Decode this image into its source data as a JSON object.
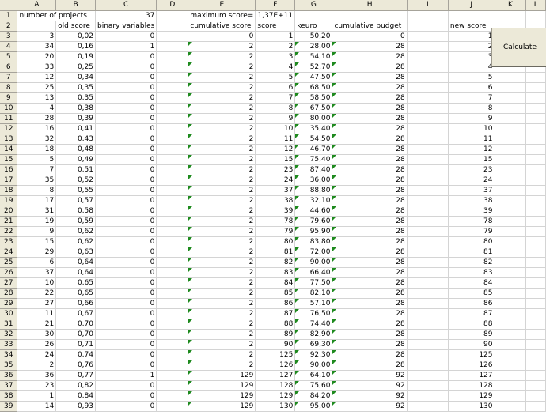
{
  "columns": [
    "A",
    "B",
    "C",
    "D",
    "E",
    "F",
    "G",
    "H",
    "I",
    "J",
    "K",
    "L"
  ],
  "row1": {
    "a": "number of projects",
    "c": "37",
    "e": "maximum score=",
    "f": "1,37E+11"
  },
  "row2": {
    "b": "old score",
    "c": "binary variables",
    "e": "cumulative score",
    "f": "score",
    "g": "keuro",
    "h": "cumulative budget",
    "j": "new score"
  },
  "rows": [
    {
      "n": "3",
      "a": "3",
      "b": "0,02",
      "c": "0",
      "e": "0",
      "f": "1",
      "g": "50,20",
      "h": "0",
      "j": "1"
    },
    {
      "n": "4",
      "a": "34",
      "b": "0,16",
      "c": "1",
      "e": "2",
      "f": "2",
      "g": "28,00",
      "h": "28",
      "j": "2"
    },
    {
      "n": "5",
      "a": "20",
      "b": "0,19",
      "c": "0",
      "e": "2",
      "f": "3",
      "g": "54,10",
      "h": "28",
      "j": "3"
    },
    {
      "n": "6",
      "a": "33",
      "b": "0,25",
      "c": "0",
      "e": "2",
      "f": "4",
      "g": "52,70",
      "h": "28",
      "j": "4"
    },
    {
      "n": "7",
      "a": "12",
      "b": "0,34",
      "c": "0",
      "e": "2",
      "f": "5",
      "g": "47,50",
      "h": "28",
      "j": "5"
    },
    {
      "n": "8",
      "a": "25",
      "b": "0,35",
      "c": "0",
      "e": "2",
      "f": "6",
      "g": "68,50",
      "h": "28",
      "j": "6"
    },
    {
      "n": "9",
      "a": "13",
      "b": "0,35",
      "c": "0",
      "e": "2",
      "f": "7",
      "g": "58,50",
      "h": "28",
      "j": "7"
    },
    {
      "n": "10",
      "a": "4",
      "b": "0,38",
      "c": "0",
      "e": "2",
      "f": "8",
      "g": "67,50",
      "h": "28",
      "j": "8"
    },
    {
      "n": "11",
      "a": "28",
      "b": "0,39",
      "c": "0",
      "e": "2",
      "f": "9",
      "g": "80,00",
      "h": "28",
      "j": "9"
    },
    {
      "n": "12",
      "a": "16",
      "b": "0,41",
      "c": "0",
      "e": "2",
      "f": "10",
      "g": "35,40",
      "h": "28",
      "j": "10"
    },
    {
      "n": "13",
      "a": "32",
      "b": "0,43",
      "c": "0",
      "e": "2",
      "f": "11",
      "g": "54,50",
      "h": "28",
      "j": "11"
    },
    {
      "n": "14",
      "a": "18",
      "b": "0,48",
      "c": "0",
      "e": "2",
      "f": "12",
      "g": "46,70",
      "h": "28",
      "j": "12"
    },
    {
      "n": "15",
      "a": "5",
      "b": "0,49",
      "c": "0",
      "e": "2",
      "f": "15",
      "g": "75,40",
      "h": "28",
      "j": "15"
    },
    {
      "n": "16",
      "a": "7",
      "b": "0,51",
      "c": "0",
      "e": "2",
      "f": "23",
      "g": "87,40",
      "h": "28",
      "j": "23"
    },
    {
      "n": "17",
      "a": "35",
      "b": "0,52",
      "c": "0",
      "e": "2",
      "f": "24",
      "g": "36,00",
      "h": "28",
      "j": "24"
    },
    {
      "n": "18",
      "a": "8",
      "b": "0,55",
      "c": "0",
      "e": "2",
      "f": "37",
      "g": "88,80",
      "h": "28",
      "j": "37"
    },
    {
      "n": "19",
      "a": "17",
      "b": "0,57",
      "c": "0",
      "e": "2",
      "f": "38",
      "g": "32,10",
      "h": "28",
      "j": "38"
    },
    {
      "n": "20",
      "a": "31",
      "b": "0,58",
      "c": "0",
      "e": "2",
      "f": "39",
      "g": "44,60",
      "h": "28",
      "j": "39"
    },
    {
      "n": "21",
      "a": "19",
      "b": "0,59",
      "c": "0",
      "e": "2",
      "f": "78",
      "g": "79,60",
      "h": "28",
      "j": "78"
    },
    {
      "n": "22",
      "a": "9",
      "b": "0,62",
      "c": "0",
      "e": "2",
      "f": "79",
      "g": "95,90",
      "h": "28",
      "j": "79"
    },
    {
      "n": "23",
      "a": "15",
      "b": "0,62",
      "c": "0",
      "e": "2",
      "f": "80",
      "g": "83,80",
      "h": "28",
      "j": "80"
    },
    {
      "n": "24",
      "a": "29",
      "b": "0,63",
      "c": "0",
      "e": "2",
      "f": "81",
      "g": "72,00",
      "h": "28",
      "j": "81"
    },
    {
      "n": "25",
      "a": "6",
      "b": "0,64",
      "c": "0",
      "e": "2",
      "f": "82",
      "g": "90,00",
      "h": "28",
      "j": "82"
    },
    {
      "n": "26",
      "a": "37",
      "b": "0,64",
      "c": "0",
      "e": "2",
      "f": "83",
      "g": "66,40",
      "h": "28",
      "j": "83"
    },
    {
      "n": "27",
      "a": "10",
      "b": "0,65",
      "c": "0",
      "e": "2",
      "f": "84",
      "g": "77,50",
      "h": "28",
      "j": "84"
    },
    {
      "n": "28",
      "a": "22",
      "b": "0,65",
      "c": "0",
      "e": "2",
      "f": "85",
      "g": "82,10",
      "h": "28",
      "j": "85"
    },
    {
      "n": "29",
      "a": "27",
      "b": "0,66",
      "c": "0",
      "e": "2",
      "f": "86",
      "g": "57,10",
      "h": "28",
      "j": "86"
    },
    {
      "n": "30",
      "a": "11",
      "b": "0,67",
      "c": "0",
      "e": "2",
      "f": "87",
      "g": "76,50",
      "h": "28",
      "j": "87"
    },
    {
      "n": "31",
      "a": "21",
      "b": "0,70",
      "c": "0",
      "e": "2",
      "f": "88",
      "g": "74,40",
      "h": "28",
      "j": "88"
    },
    {
      "n": "32",
      "a": "30",
      "b": "0,70",
      "c": "0",
      "e": "2",
      "f": "89",
      "g": "82,90",
      "h": "28",
      "j": "89"
    },
    {
      "n": "33",
      "a": "26",
      "b": "0,71",
      "c": "0",
      "e": "2",
      "f": "90",
      "g": "69,30",
      "h": "28",
      "j": "90"
    },
    {
      "n": "34",
      "a": "24",
      "b": "0,74",
      "c": "0",
      "e": "2",
      "f": "125",
      "g": "92,30",
      "h": "28",
      "j": "125"
    },
    {
      "n": "35",
      "a": "2",
      "b": "0,76",
      "c": "0",
      "e": "2",
      "f": "126",
      "g": "90,00",
      "h": "28",
      "j": "126"
    },
    {
      "n": "36",
      "a": "36",
      "b": "0,77",
      "c": "1",
      "e": "129",
      "f": "127",
      "g": "64,10",
      "h": "92",
      "j": "127"
    },
    {
      "n": "37",
      "a": "23",
      "b": "0,82",
      "c": "0",
      "e": "129",
      "f": "128",
      "g": "75,60",
      "h": "92",
      "j": "128"
    },
    {
      "n": "38",
      "a": "1",
      "b": "0,84",
      "c": "0",
      "e": "129",
      "f": "129",
      "g": "84,20",
      "h": "92",
      "j": "129"
    },
    {
      "n": "39",
      "a": "14",
      "b": "0,93",
      "c": "0",
      "e": "129",
      "f": "130",
      "g": "95,00",
      "h": "92",
      "j": "130"
    }
  ],
  "button": {
    "label": "Calculate"
  },
  "colors": {
    "header_bg": "#ece9d8",
    "gridline": "#d4d4d4",
    "error_flag": "#1e8a1e"
  }
}
